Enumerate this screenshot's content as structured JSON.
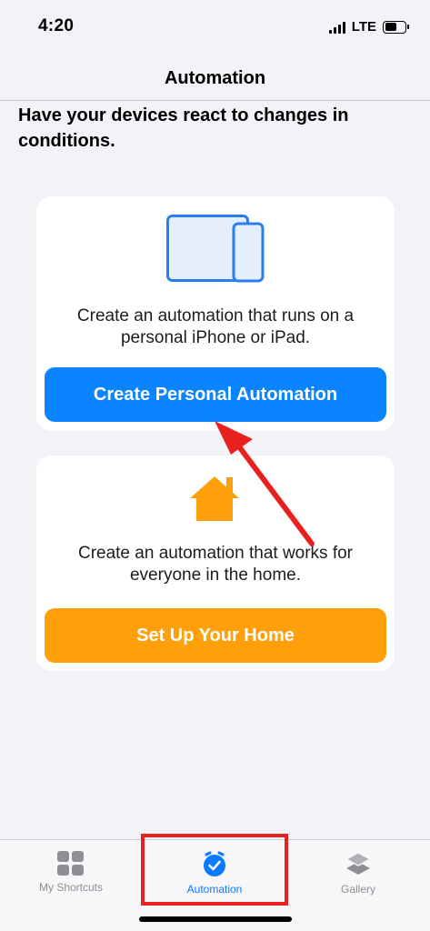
{
  "status_bar": {
    "time": "4:20",
    "network": "LTE",
    "signal_icon": "signal-bars-icon",
    "battery_icon": "battery-icon"
  },
  "nav": {
    "title": "Automation"
  },
  "intro": {
    "text": "Have your devices react to changes in conditions."
  },
  "personal_card": {
    "icon": "ipad-iphone-icon",
    "description": "Create an automation that runs on a personal iPhone or iPad.",
    "button_label": "Create Personal Automation",
    "button_color": "#0a84ff"
  },
  "home_card": {
    "icon": "house-icon",
    "description": "Create an automation that works for everyone in the home.",
    "button_label": "Set Up Your Home",
    "button_color": "#ff9f0a"
  },
  "tab_bar": {
    "tabs": [
      {
        "label": "My Shortcuts",
        "icon": "grid-icon",
        "selected": false
      },
      {
        "label": "Automation",
        "icon": "clock-check-icon",
        "selected": true
      },
      {
        "label": "Gallery",
        "icon": "layers-icon",
        "selected": false
      }
    ]
  },
  "colors": {
    "accent": "#0a7aff",
    "annotation": "#e8201f",
    "background": "#f2f2f7"
  }
}
